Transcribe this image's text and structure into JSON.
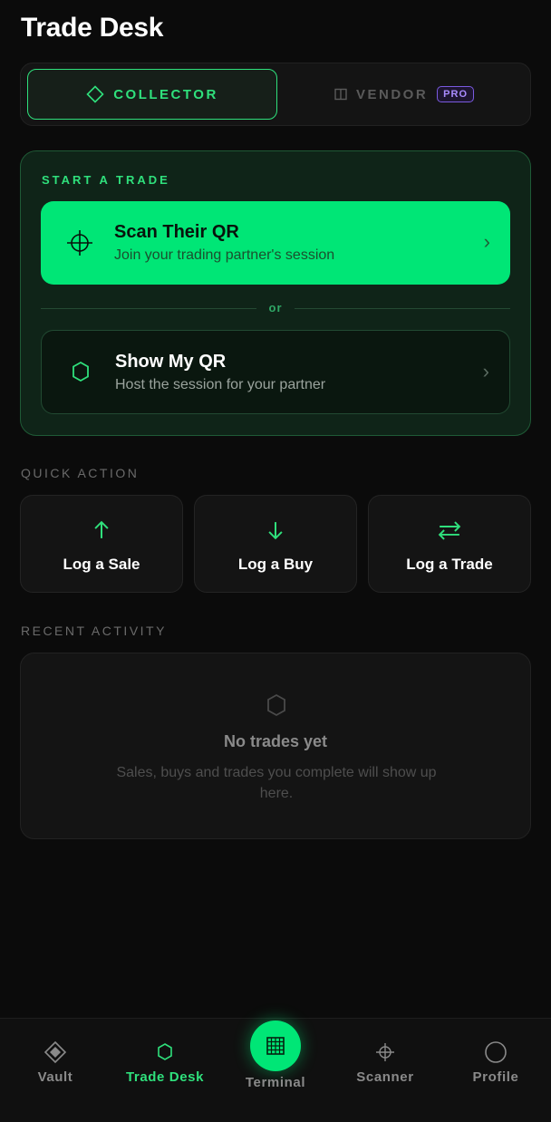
{
  "header": {
    "title": "Trade Desk"
  },
  "mode_switch": {
    "collector_label": "COLLECTOR",
    "vendor_label": "VENDOR",
    "pro_badge": "PRO",
    "active": "collector"
  },
  "start_trade": {
    "section_label": "START A TRADE",
    "scan": {
      "title": "Scan Their QR",
      "subtitle": "Join your trading partner's session"
    },
    "divider": "or",
    "show": {
      "title": "Show My QR",
      "subtitle": "Host the session for your partner"
    }
  },
  "quick_action": {
    "section_label": "QUICK ACTION",
    "items": [
      {
        "label": "Log a Sale",
        "icon": "arrow-up-icon"
      },
      {
        "label": "Log a Buy",
        "icon": "arrow-down-icon"
      },
      {
        "label": "Log a Trade",
        "icon": "swap-arrows-icon"
      }
    ]
  },
  "recent_activity": {
    "section_label": "RECENT ACTIVITY",
    "empty_title": "No trades yet",
    "empty_body": "Sales, buys and trades you complete will show up here."
  },
  "nav": {
    "items": [
      {
        "label": "Vault",
        "icon": "diamond-icon"
      },
      {
        "label": "Trade Desk",
        "icon": "hexagon-icon",
        "active": true
      },
      {
        "label": "Terminal",
        "icon": "grid-icon"
      },
      {
        "label": "Scanner",
        "icon": "crosshair-icon"
      },
      {
        "label": "Profile",
        "icon": "circle-icon"
      }
    ]
  },
  "colors": {
    "accent": "#00E676",
    "background": "#0B0B0B",
    "card": "#141414",
    "pro": "#A98BFF"
  }
}
